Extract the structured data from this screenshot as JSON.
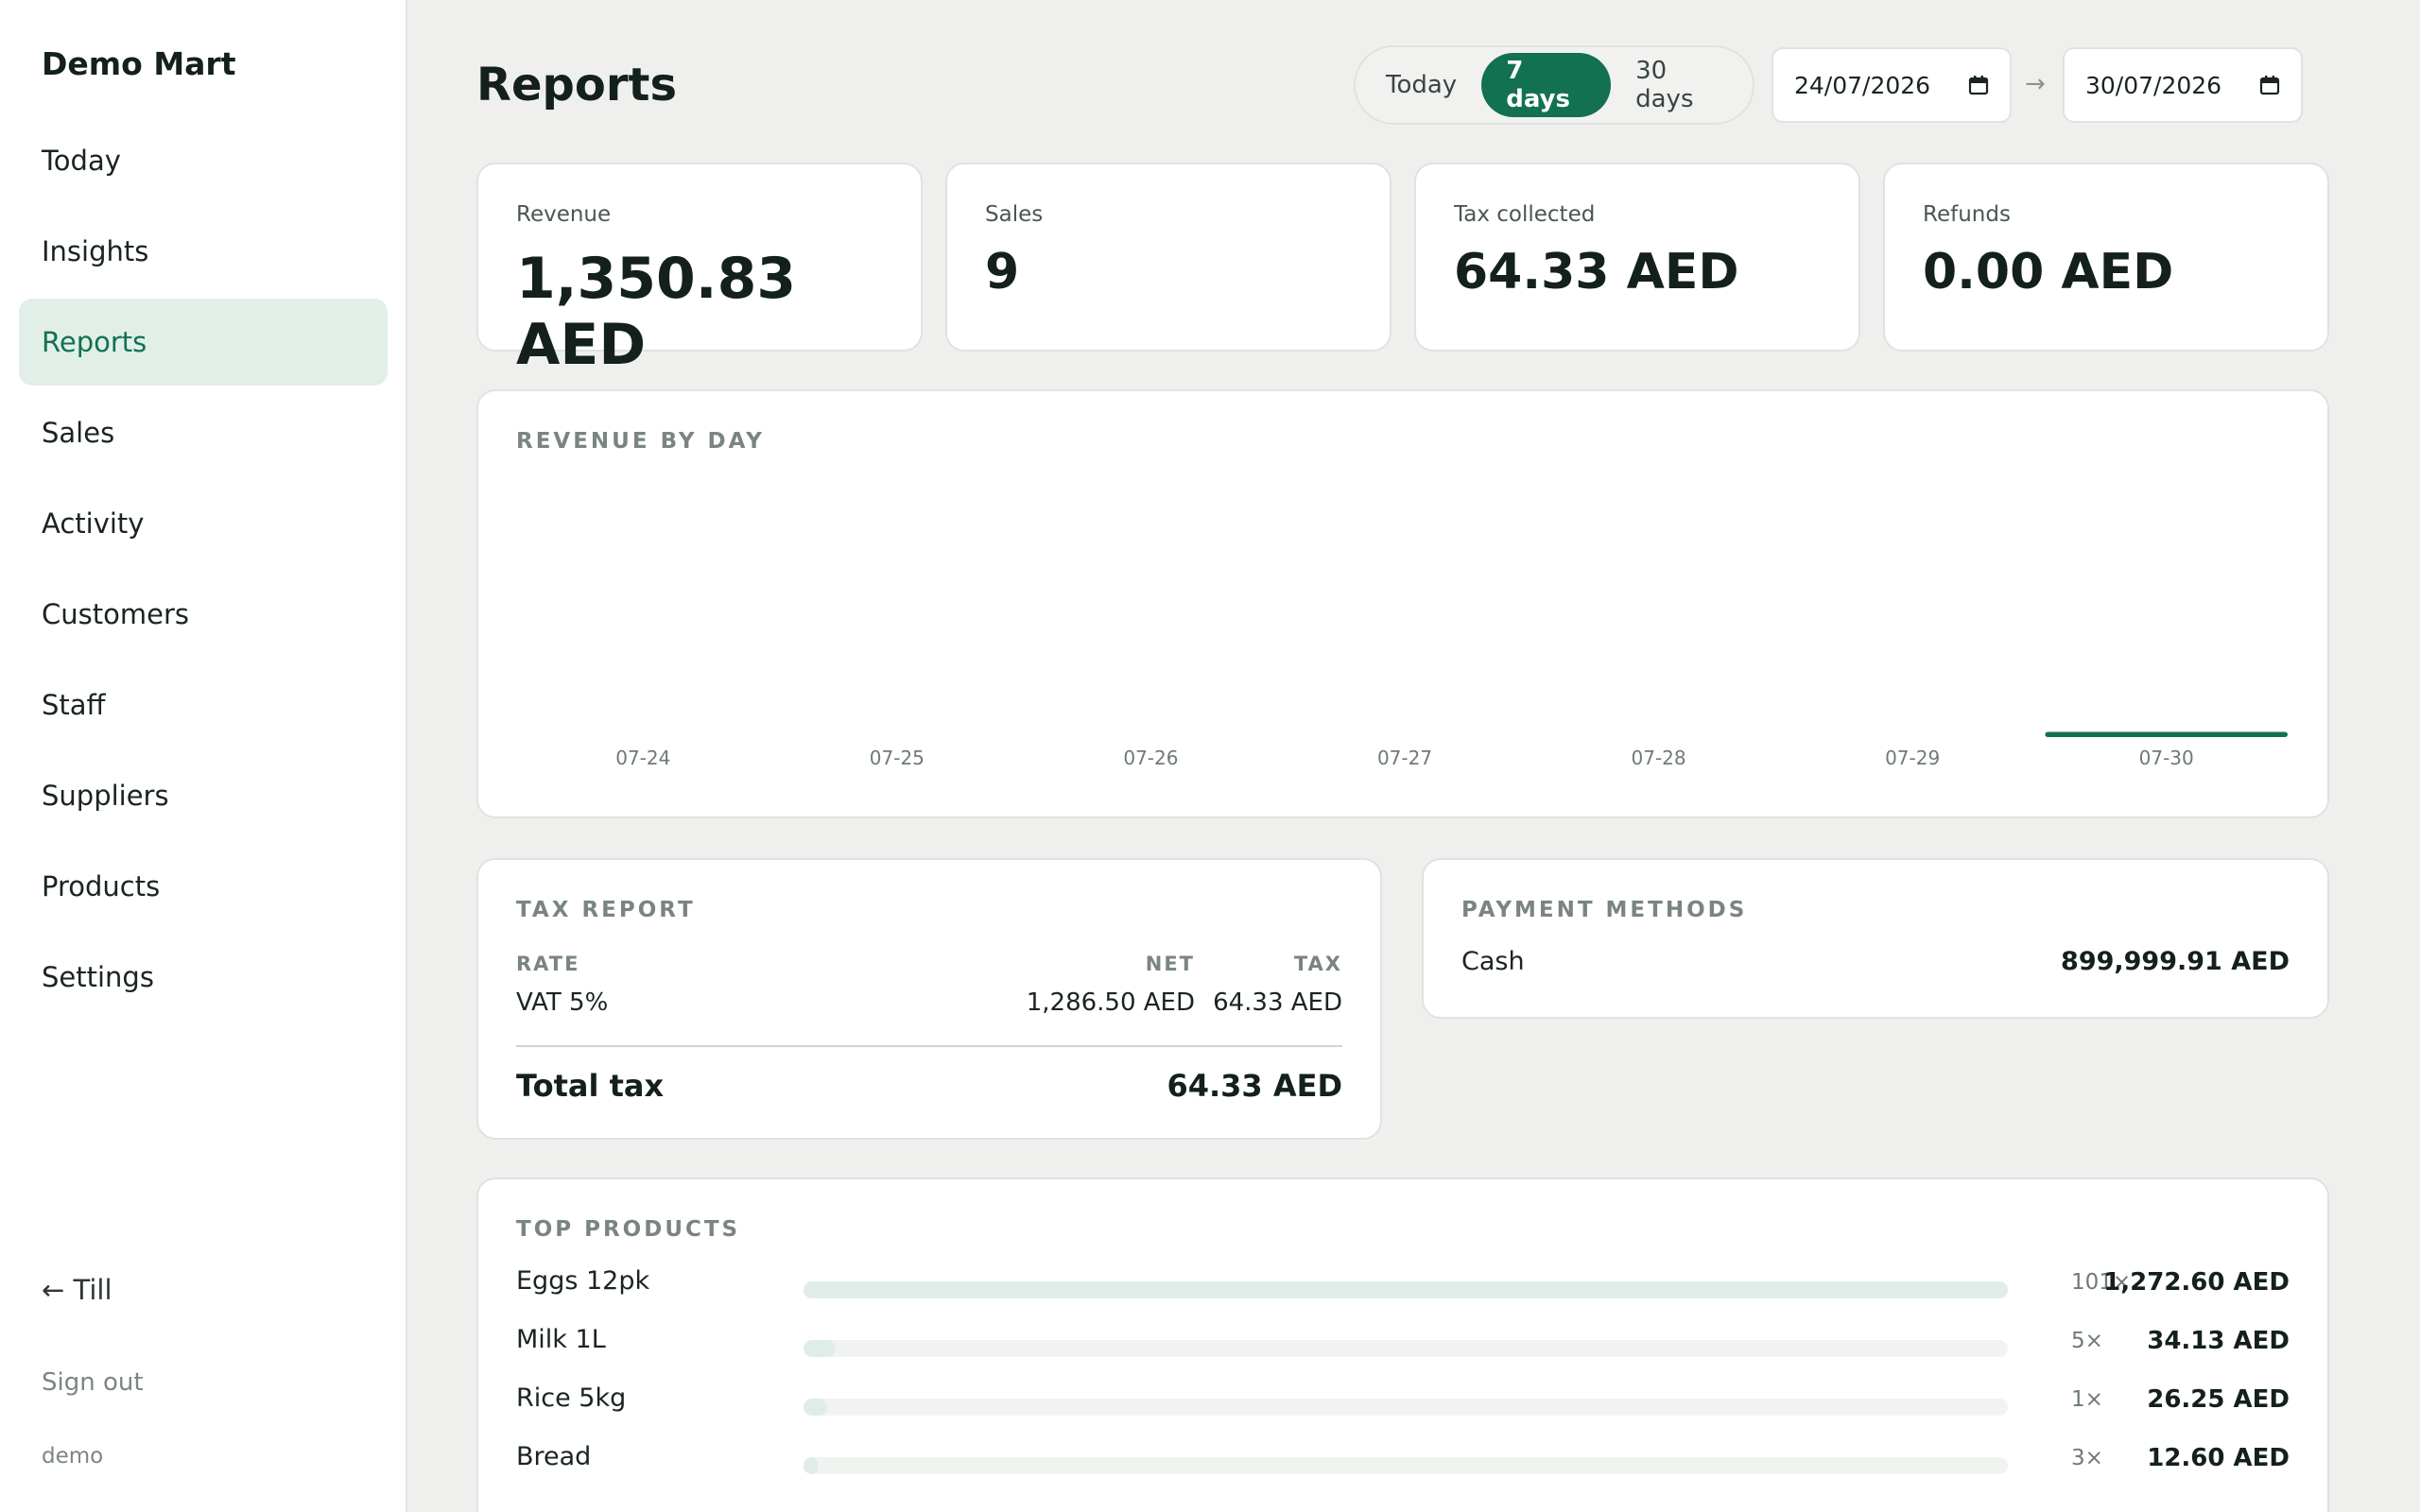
{
  "sidebar": {
    "brand": "Demo Mart",
    "items": [
      {
        "label": "Today"
      },
      {
        "label": "Insights"
      },
      {
        "label": "Reports"
      },
      {
        "label": "Sales"
      },
      {
        "label": "Activity"
      },
      {
        "label": "Customers"
      },
      {
        "label": "Staff"
      },
      {
        "label": "Suppliers"
      },
      {
        "label": "Products"
      },
      {
        "label": "Settings"
      }
    ],
    "active": "Reports",
    "till_label": "← Till",
    "signout_label": "Sign out",
    "username": "demo"
  },
  "header": {
    "title": "Reports",
    "ranges": [
      "Today",
      "7 days",
      "30 days"
    ],
    "active_range": "7 days",
    "date_from": "24/07/2026",
    "date_to": "30/07/2026",
    "date_arrow": "→"
  },
  "kpis": [
    {
      "label": "Revenue",
      "value": "1,350.83 AED"
    },
    {
      "label": "Sales",
      "value": "9"
    },
    {
      "label": "Tax collected",
      "value": "64.33 AED"
    },
    {
      "label": "Refunds",
      "value": "0.00 AED"
    }
  ],
  "revenue_chart": {
    "title": "REVENUE BY DAY"
  },
  "chart_data": {
    "type": "bar",
    "categories": [
      "07-24",
      "07-25",
      "07-26",
      "07-27",
      "07-28",
      "07-29",
      "07-30"
    ],
    "values": [
      0,
      0,
      0,
      0,
      0,
      0,
      1350.83
    ],
    "title": "REVENUE BY DAY",
    "xlabel": "",
    "ylabel": "",
    "grid": false,
    "legend": "none",
    "bar_color": "#127150"
  },
  "tax_report": {
    "title": "TAX REPORT",
    "headers": {
      "rate": "RATE",
      "net": "NET",
      "tax": "TAX"
    },
    "rows": [
      {
        "rate": "VAT 5%",
        "net": "1,286.50 AED",
        "tax": "64.33 AED"
      }
    ],
    "total_label": "Total tax",
    "total_value": "64.33 AED"
  },
  "payment_methods": {
    "title": "PAYMENT METHODS",
    "rows": [
      {
        "method": "Cash",
        "amount": "899,999.91 AED"
      }
    ]
  },
  "top_products": {
    "title": "TOP PRODUCTS",
    "items": [
      {
        "name": "Eggs 12pk",
        "qty": "101×",
        "amount": "1,272.60 AED",
        "share": 1.0
      },
      {
        "name": "Milk 1L",
        "qty": "5×",
        "amount": "34.13 AED",
        "share": 0.027
      },
      {
        "name": "Rice 5kg",
        "qty": "1×",
        "amount": "26.25 AED",
        "share": 0.02
      },
      {
        "name": "Bread",
        "qty": "3×",
        "amount": "12.60 AED",
        "share": 0.01
      }
    ]
  },
  "colors": {
    "accent": "#127150",
    "accent_soft": "#e1efe8",
    "bar_soft": "#e0ede7",
    "background": "#eff0ed"
  }
}
